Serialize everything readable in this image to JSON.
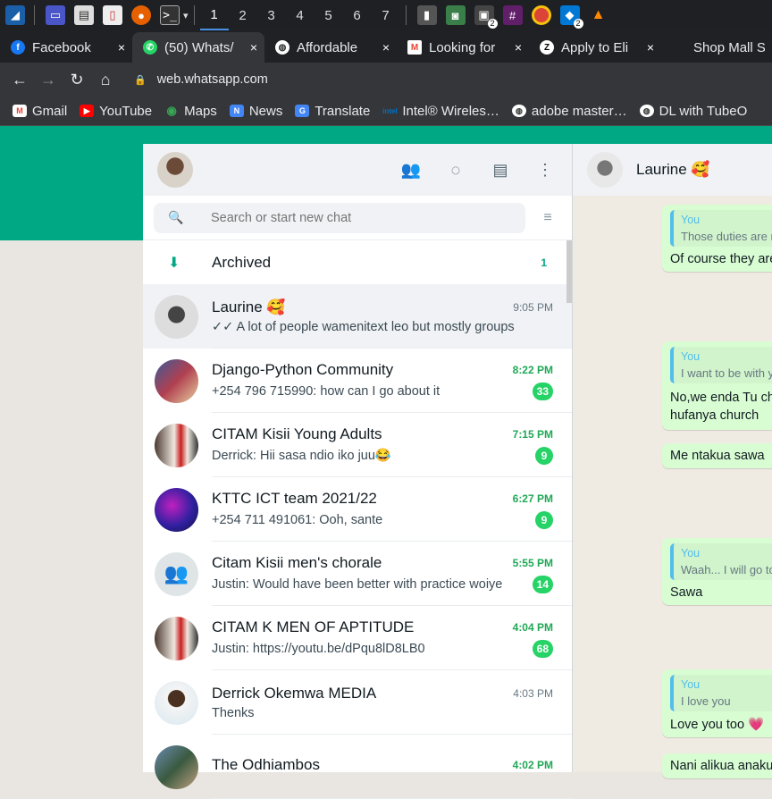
{
  "taskbar": {
    "workspaces": [
      "1",
      "2",
      "3",
      "4",
      "5",
      "6",
      "7"
    ],
    "badges": [
      "2",
      "2"
    ]
  },
  "browser": {
    "tabs": [
      {
        "title": "Facebook",
        "close": "×"
      },
      {
        "title": "(50) Whats/",
        "close": "×"
      },
      {
        "title": "Affordable",
        "close": "×"
      },
      {
        "title": "Looking for",
        "close": "×"
      },
      {
        "title": "Apply to Eli",
        "close": "×"
      },
      {
        "title": "Shop Mall S",
        "close": ""
      }
    ],
    "url": "web.whatsapp.com",
    "bookmarks": [
      "Gmail",
      "YouTube",
      "Maps",
      "News",
      "Translate",
      "Intel® Wireles…",
      "adobe master…",
      "DL with TubeO"
    ]
  },
  "sidebar": {
    "search_placeholder": "Search or start new chat",
    "archived_label": "Archived",
    "archived_count": "1",
    "chats": [
      {
        "name": "Laurine 🥰",
        "time": "9:05 PM",
        "msg": "✓✓ A lot of people wamenitext leo but mostly groups",
        "badge": ""
      },
      {
        "name": "Django-Python Community",
        "time": "8:22 PM",
        "msg": "+254 796 715990: how can I go about it",
        "badge": "33"
      },
      {
        "name": "CITAM Kisii Young Adults",
        "time": "7:15 PM",
        "msg": "Derrick: Hii sasa ndio iko juu😂",
        "badge": "9"
      },
      {
        "name": "KTTC ICT team 2021/22",
        "time": "6:27 PM",
        "msg": "+254 711 491061: Ooh, sante",
        "badge": "9"
      },
      {
        "name": "Citam Kisii men's chorale",
        "time": "5:55 PM",
        "msg": "Justin: Would have been better with practice woiye",
        "badge": "14"
      },
      {
        "name": "CITAM K MEN OF APTITUDE",
        "time": "4:04 PM",
        "msg": "Justin: https://youtu.be/dPqu8lD8LB0",
        "badge": "68"
      },
      {
        "name": "Derrick Okemwa MEDIA",
        "time": "4:03 PM",
        "msg": "Thenks",
        "badge": ""
      },
      {
        "name": "The Odhiambos",
        "time": "4:02 PM",
        "msg": "",
        "badge": ""
      }
    ]
  },
  "conversation": {
    "contact_name": "Laurine 🥰",
    "messages": [
      {
        "quote_author": "You",
        "quote": "Those duties are n",
        "text": "Of course they are"
      },
      {
        "quote_author": "You",
        "quote": "I want to be with y",
        "text": "No,we enda Tu ch\nhufanya church"
      },
      {
        "quote_author": "",
        "quote": "",
        "text": "Me ntakua sawa"
      },
      {
        "quote_author": "You",
        "quote": "Waah... I will go to",
        "text": "Sawa"
      },
      {
        "quote_author": "You",
        "quote": "I love you",
        "text": "Love you too 💗"
      },
      {
        "quote_author": "",
        "quote": "",
        "text": "Nani alikua anaku"
      }
    ]
  }
}
